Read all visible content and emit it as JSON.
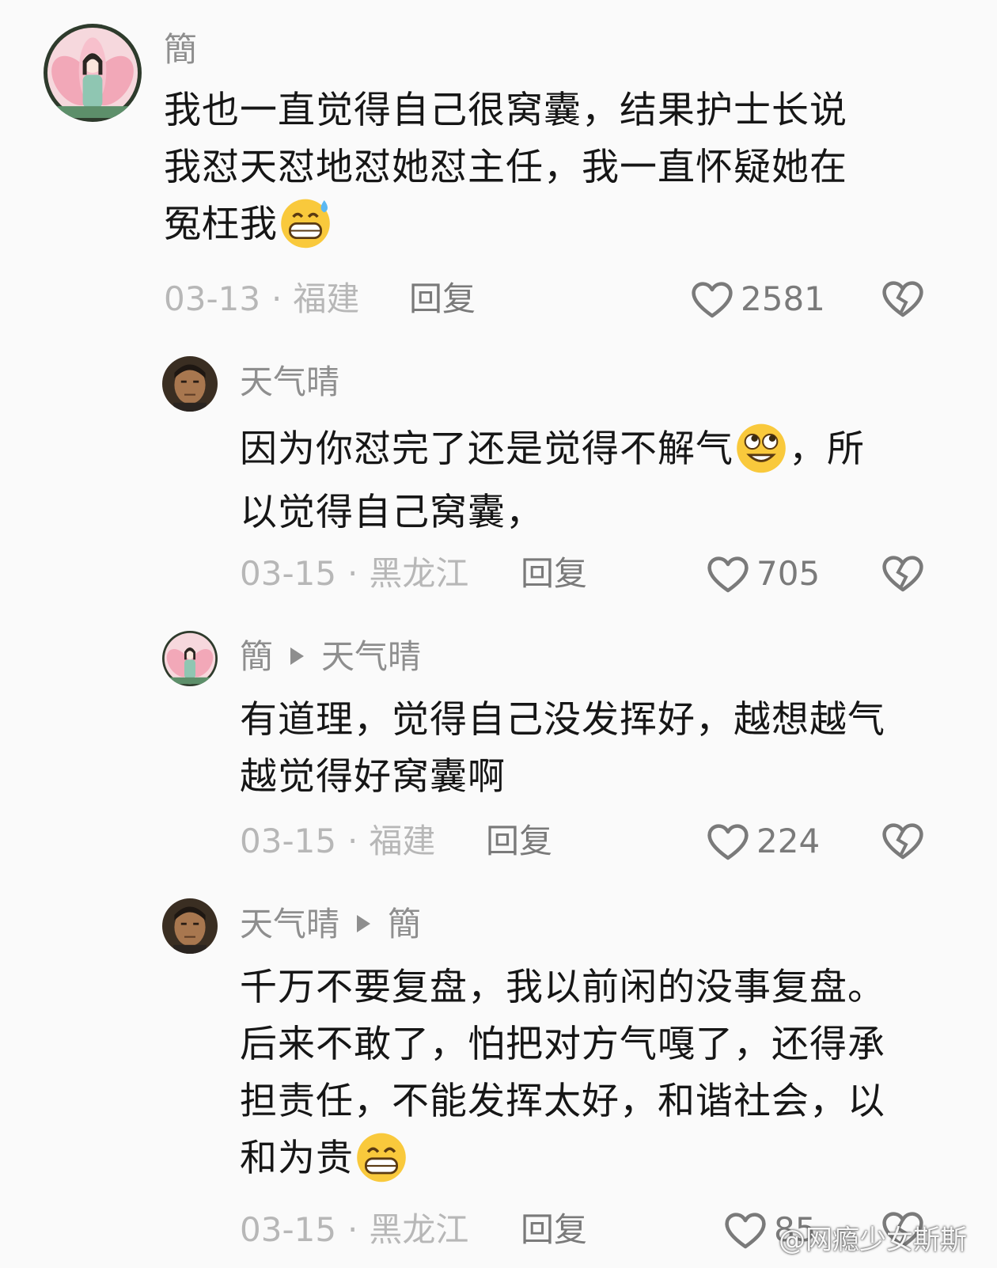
{
  "comments": [
    {
      "username": "簡",
      "reply_to": "",
      "text_lines": [
        "我也一直觉得自己很窝囊，结果护士长说",
        "我怼天怼地怼她怼主任，我一直怀疑她在",
        "冤枉我"
      ],
      "emoji": "grinning-sweat-emoji",
      "date": "03-13",
      "location": "福建",
      "reply_label": "回复",
      "likes": "2581"
    },
    {
      "username": "天气晴",
      "reply_to": "",
      "text_lines": [
        "因为你怼完了还是觉得不解气",
        "，所",
        "以觉得自己窝囊，"
      ],
      "emoji": "rolling-eyes-smile-emoji",
      "date": "03-15",
      "location": "黑龙江",
      "reply_label": "回复",
      "likes": "705"
    },
    {
      "username": "簡",
      "reply_to": "天气晴",
      "text_lines": [
        "有道理，觉得自己没发挥好，越想越气",
        "越觉得好窝囊啊"
      ],
      "date": "03-15",
      "location": "福建",
      "reply_label": "回复",
      "likes": "224"
    },
    {
      "username": "天气晴",
      "reply_to": "簡",
      "text_lines": [
        "千万不要复盘，我以前闲的没事复盘。",
        "后来不敢了，怕把对方气嘎了，还得承",
        "担责任，不能发挥太好，和谐社会，以",
        "和为贵"
      ],
      "emoji": "grinning-squint-emoji",
      "date": "03-15",
      "location": "黑龙江",
      "reply_label": "回复",
      "likes": "85"
    }
  ],
  "separator": "·",
  "watermark": "@网瘾少女斯斯",
  "colors": {
    "background": "#fafafa",
    "username": "#8e8e8e",
    "meta": "#b7b7b7",
    "icon": "#7a7a7a"
  }
}
